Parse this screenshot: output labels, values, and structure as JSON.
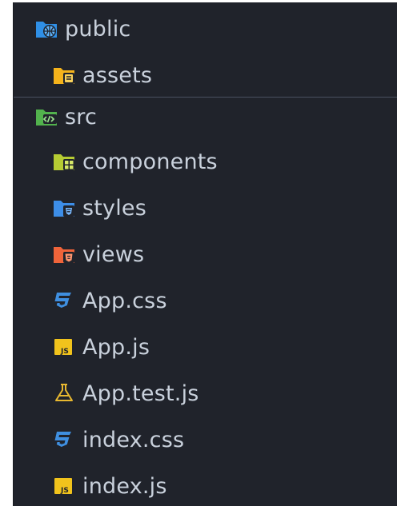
{
  "explorer": {
    "items": [
      {
        "label": "public",
        "icon": "folder-public-icon"
      },
      {
        "label": "assets",
        "icon": "folder-assets-icon"
      },
      {
        "label": "src",
        "icon": "folder-src-icon"
      },
      {
        "label": "components",
        "icon": "folder-components-icon"
      },
      {
        "label": "styles",
        "icon": "folder-styles-icon"
      },
      {
        "label": "views",
        "icon": "folder-views-icon"
      },
      {
        "label": "App.css",
        "icon": "css-file-icon"
      },
      {
        "label": "App.js",
        "icon": "js-file-icon"
      },
      {
        "label": "App.test.js",
        "icon": "test-file-icon"
      },
      {
        "label": "index.css",
        "icon": "css-file-icon"
      },
      {
        "label": "index.js",
        "icon": "js-file-icon"
      }
    ]
  },
  "icon_text": {
    "js": "JS"
  },
  "colors": {
    "background": "#20232b",
    "text": "#c9d1dc",
    "folder_public": "#2f8fe6",
    "folder_assets": "#f5b31b",
    "folder_src": "#52b24d",
    "folder_components": "#b6cc33",
    "folder_styles": "#3d8ee8",
    "folder_views": "#f0643a",
    "css": "#3f8fe0",
    "js": "#f1c31c",
    "test": "#e8b830"
  }
}
